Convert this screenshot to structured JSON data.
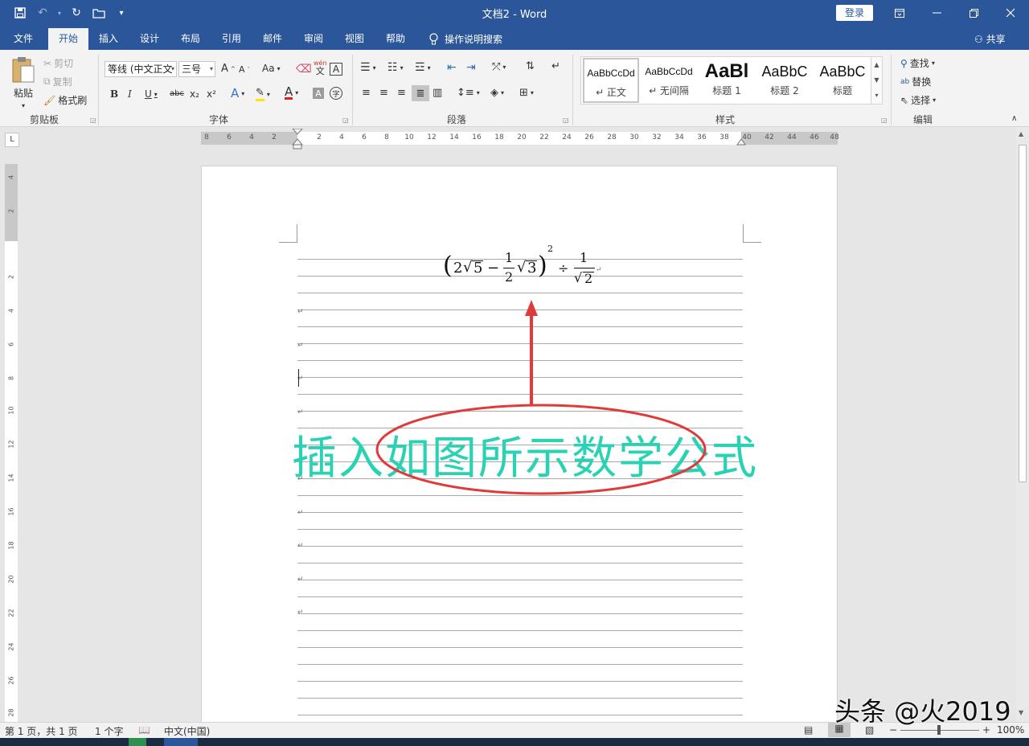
{
  "window": {
    "title": "文档2  -  Word",
    "login_label": "登录"
  },
  "qat": {
    "save_icon": "save-icon",
    "undo_icon": "undo-icon",
    "redo_icon": "redo-icon",
    "open_icon": "open-folder-icon",
    "customize_icon": "customize-qat-icon"
  },
  "tabs": [
    {
      "label": "文件"
    },
    {
      "label": "开始"
    },
    {
      "label": "插入"
    },
    {
      "label": "设计"
    },
    {
      "label": "布局"
    },
    {
      "label": "引用"
    },
    {
      "label": "邮件"
    },
    {
      "label": "审阅"
    },
    {
      "label": "视图"
    },
    {
      "label": "帮助"
    }
  ],
  "tell_me": "操作说明搜索",
  "share_label": "共享",
  "clipboard": {
    "paste": "粘贴",
    "cut": "剪切",
    "copy": "复制",
    "format_painter": "格式刷",
    "group": "剪贴板"
  },
  "font": {
    "name": "等线 (中文正文",
    "size": "三号",
    "change_case": "Aa",
    "bold": "B",
    "italic": "I",
    "underline": "U",
    "strike": "abc",
    "sub": "x₂",
    "sup": "x²",
    "phonetic_top": "wén",
    "phonetic_bottom": "文",
    "border_char": "A",
    "shade_char": "A",
    "circle_char": "字",
    "group": "字体"
  },
  "paragraph": {
    "group": "段落"
  },
  "styles": {
    "items": [
      {
        "preview": "AaBbCcDd",
        "name": "↵ 正文"
      },
      {
        "preview": "AaBbCcDd",
        "name": "↵ 无间隔"
      },
      {
        "preview": "AaBl",
        "name": "标题 1"
      },
      {
        "preview": "AaBbC",
        "name": "标题 2"
      },
      {
        "preview": "AaBbC",
        "name": "标题"
      }
    ],
    "group": "样式"
  },
  "editing": {
    "find": "查找",
    "replace": "替换",
    "select": "选择",
    "group": "编辑"
  },
  "ruler": {
    "tab_selector": "L",
    "left_ticks": [
      "8",
      "6",
      "4",
      "2"
    ],
    "right_ticks": [
      "2",
      "4",
      "6",
      "8",
      "10",
      "12",
      "14",
      "16",
      "18",
      "20",
      "22",
      "24",
      "26",
      "28",
      "30",
      "32",
      "34",
      "36",
      "38",
      "40",
      "42",
      "44",
      "46",
      "48"
    ],
    "vertical_ticks": [
      "4",
      "2",
      "2",
      "4",
      "6",
      "8",
      "10",
      "12",
      "14",
      "16",
      "18",
      "20",
      "22",
      "24",
      "26",
      "28"
    ]
  },
  "document": {
    "paragraph_mark": "↵",
    "equation": {
      "open_paren": "(",
      "two": "2",
      "sqrt_sign": "√",
      "five": "5",
      "minus": "−",
      "frac_num": "1",
      "frac_den": "2",
      "three": "3",
      "close_paren": ")",
      "exponent": "2",
      "divide": "÷",
      "frac2_num": "1",
      "frac2_den": "2"
    },
    "caption": "插入如图所示数学公式"
  },
  "status": {
    "page": "第 1 页，共 1 页",
    "words": "1 个字",
    "language": "中文(中国)",
    "zoom": "100%"
  },
  "watermark": "头条 @火2019",
  "colors": {
    "brand": "#2b579a",
    "caption": "#2ad2b4",
    "annotation": "#e03a3a"
  }
}
